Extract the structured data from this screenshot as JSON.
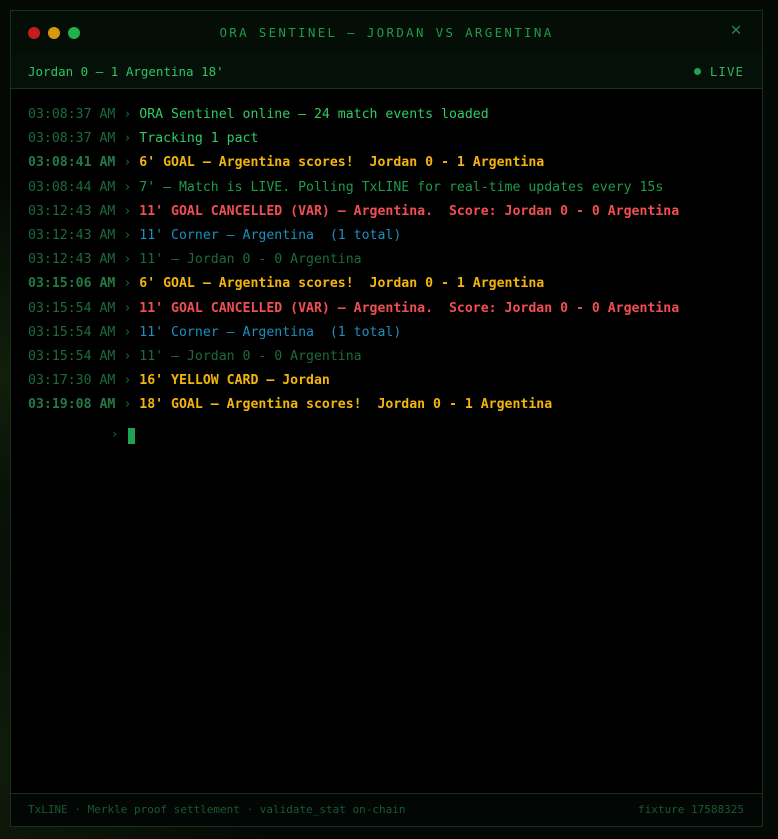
{
  "window": {
    "title": "ORA SENTINEL — JORDAN VS ARGENTINA",
    "close_symbol": "✕"
  },
  "scorebar": {
    "score": "Jordan 0 — 1 Argentina 18'",
    "live_label": "LIVE"
  },
  "log": [
    {
      "time": "03:08:37 AM",
      "message": "ORA Sentinel online — 24 match events loaded",
      "kind": "system"
    },
    {
      "time": "03:08:37 AM",
      "message": "Tracking 1 pact",
      "kind": "system"
    },
    {
      "time": "03:08:41 AM",
      "message": "6' GOAL — Argentina scores!  Jordan 0 - 1 Argentina",
      "kind": "goal"
    },
    {
      "time": "03:08:44 AM",
      "message": "7' — Match is LIVE. Polling TxLINE for real-time updates every 15s",
      "kind": "info"
    },
    {
      "time": "03:12:43 AM",
      "message": "11' GOAL CANCELLED (VAR) — Argentina.  Score: Jordan 0 - 0 Argentina",
      "kind": "cancel"
    },
    {
      "time": "03:12:43 AM",
      "message": "11' Corner — Argentina  (1 total)",
      "kind": "corner"
    },
    {
      "time": "03:12:43 AM",
      "message": "11' — Jordan 0 - 0 Argentina",
      "kind": "dim"
    },
    {
      "time": "03:15:06 AM",
      "message": "6' GOAL — Argentina scores!  Jordan 0 - 1 Argentina",
      "kind": "goal"
    },
    {
      "time": "03:15:54 AM",
      "message": "11' GOAL CANCELLED (VAR) — Argentina.  Score: Jordan 0 - 0 Argentina",
      "kind": "cancel"
    },
    {
      "time": "03:15:54 AM",
      "message": "11' Corner — Argentina  (1 total)",
      "kind": "corner"
    },
    {
      "time": "03:15:54 AM",
      "message": "11' — Jordan 0 - 0 Argentina",
      "kind": "dim"
    },
    {
      "time": "03:17:30 AM",
      "message": "16' YELLOW CARD — Jordan",
      "kind": "yellowcard"
    },
    {
      "time": "03:19:08 AM",
      "message": "18' GOAL — Argentina scores!  Jordan 0 - 1 Argentina",
      "kind": "goal"
    }
  ],
  "log_arrow": "›",
  "prompt_arrow": "›",
  "footer": {
    "left": "TxLINE · Merkle proof settlement · validate_stat on-chain",
    "right": "fixture 17588325"
  },
  "colors": {
    "goal": "#f2b40f",
    "cancel": "#ef4f52",
    "corner": "#1e8fbd",
    "system": "#2fcc66",
    "info": "#1f9a4c",
    "live_dot": "#1fa352"
  }
}
